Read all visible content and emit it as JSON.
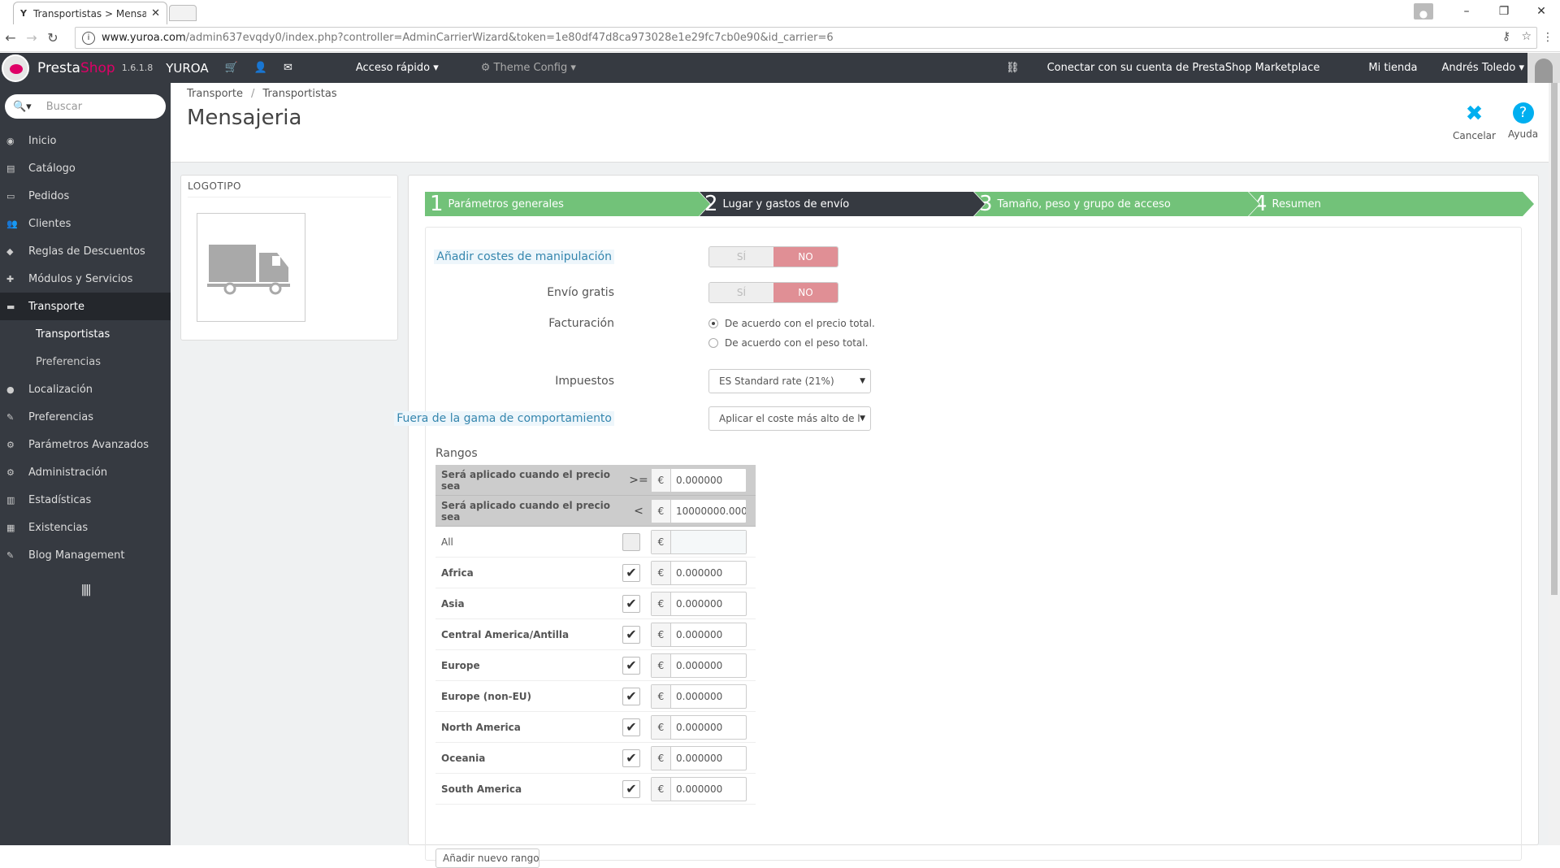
{
  "browser": {
    "tab_title": "Transportistas > Mensaje",
    "tab_favicon": "Y",
    "url_host": "www.yuroa.com",
    "url_path": "/admin637evqdy0/index.php?controller=AdminCarrierWizard&token=1e80df47d8ca973028e1e29fc7cb0e90&id_carrier=6"
  },
  "header": {
    "brand_a": "Presta",
    "brand_b": "Shop",
    "version": "1.6.1.8",
    "shop_name": "YUROA",
    "quick_access": "Acceso rápido ▾",
    "theme_config": "Theme Config ▾",
    "marketplace": "Conectar con su cuenta de PrestaShop Marketplace",
    "my_shop": "Mi tienda",
    "user": "Andrés Toledo ▾"
  },
  "sidebar": {
    "search_placeholder": "Buscar",
    "items": [
      {
        "label": "Inicio",
        "icon": "dashboard-icon"
      },
      {
        "label": "Catálogo",
        "icon": "catalog-icon"
      },
      {
        "label": "Pedidos",
        "icon": "orders-icon"
      },
      {
        "label": "Clientes",
        "icon": "customers-icon"
      },
      {
        "label": "Reglas de Descuentos",
        "icon": "tag-icon"
      },
      {
        "label": "Módulos y Servicios",
        "icon": "puzzle-icon"
      },
      {
        "label": "Transporte",
        "icon": "truck-icon"
      },
      {
        "label": "Localización",
        "icon": "globe-icon"
      },
      {
        "label": "Preferencias",
        "icon": "wrench-icon"
      },
      {
        "label": "Parámetros Avanzados",
        "icon": "cogs-icon"
      },
      {
        "label": "Administración",
        "icon": "gear-icon"
      },
      {
        "label": "Estadísticas",
        "icon": "bar-chart-icon"
      },
      {
        "label": "Existencias",
        "icon": "stock-icon"
      },
      {
        "label": "Blog Management",
        "icon": "pencil-icon"
      }
    ],
    "sub_items": [
      {
        "label": "Transportistas"
      },
      {
        "label": "Preferencias"
      }
    ]
  },
  "toolbar": {
    "breadcrumb": [
      "Transporte",
      "Transportistas"
    ],
    "page_title": "Mensajeria",
    "cancel_label": "Cancelar",
    "help_label": "Ayuda"
  },
  "logo_panel": {
    "heading": "LOGOTIPO"
  },
  "steps": [
    {
      "num": "1",
      "label": "Parámetros generales"
    },
    {
      "num": "2",
      "label": "Lugar y gastos de envío"
    },
    {
      "num": "3",
      "label": "Tamaño, peso y grupo de acceso"
    },
    {
      "num": "4",
      "label": "Resumen"
    }
  ],
  "form": {
    "handling_label": "Añadir costes de manipulación",
    "free_shipping_label": "Envío gratis",
    "switch_yes": "SÍ",
    "switch_no": "NO",
    "billing_label": "Facturación",
    "billing_price": "De acuerdo con el precio total.",
    "billing_weight": "De acuerdo con el peso total.",
    "tax_label": "Impuestos",
    "tax_value": "ES Standard rate (21%)",
    "out_of_range_label": "Fuera de la gama de comportamiento",
    "out_of_range_value": "Aplicar el coste más alto de l",
    "ranges_title": "Rangos",
    "range_from_label": "Será aplicado cuando el precio sea",
    "range_from_op": ">=",
    "range_from_value": "0.000000",
    "range_to_label": "Será aplicado cuando el precio sea",
    "range_to_op": "<",
    "range_to_value": "10000000.000",
    "currency": "€",
    "all_label": "All",
    "zones": [
      {
        "name": "Africa",
        "value": "0.000000"
      },
      {
        "name": "Asia",
        "value": "0.000000"
      },
      {
        "name": "Central America/Antilla",
        "value": "0.000000"
      },
      {
        "name": "Europe",
        "value": "0.000000"
      },
      {
        "name": "Europe (non-EU)",
        "value": "0.000000"
      },
      {
        "name": "North America",
        "value": "0.000000"
      },
      {
        "name": "Oceania",
        "value": "0.000000"
      },
      {
        "name": "South America",
        "value": "0.000000"
      }
    ],
    "add_range_label": "Añadir nuevo rango"
  }
}
